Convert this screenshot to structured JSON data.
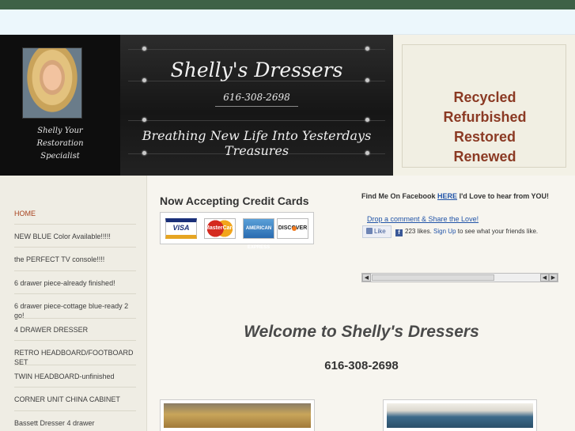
{
  "header": {
    "site_title": "Shelly's Dressers",
    "phone": "616-308-2698",
    "tagline": "Breathing New Life Into Yesterdays Treasures",
    "caption": [
      "Shelly Your",
      "Restoration",
      "Specialist"
    ],
    "words": [
      "Recycled",
      "Refurbished",
      "Restored",
      "Renewed"
    ]
  },
  "sidebar": {
    "items": [
      {
        "label": "HOME",
        "active": true
      },
      {
        "label": "NEW BLUE Color Available!!!!!"
      },
      {
        "label": "the PERFECT TV console!!!!"
      },
      {
        "label": "6 drawer piece-already finished!"
      },
      {
        "label": "6 drawer piece-cottage blue-ready 2 go!"
      },
      {
        "label": "4 DRAWER DRESSER"
      },
      {
        "label": "RETRO HEADBOARD/FOOTBOARD SET"
      },
      {
        "label": "TWIN HEADBOARD-unfinished"
      },
      {
        "label": "CORNER UNIT CHINA CABINET"
      },
      {
        "label": "Bassett Dresser 4 drawer"
      }
    ]
  },
  "credit": {
    "title": "Now Accepting Credit Cards",
    "cards": [
      "VISA",
      "MasterCard",
      "AMERICAN EXPRESS",
      "DISCOVER"
    ]
  },
  "facebook": {
    "prefix": "Find Me On Facebook",
    "link": "HERE",
    "suffix": "I'd Love to hear from YOU!",
    "drop": "Drop a comment & Share the Love!",
    "like": "Like",
    "count_text": "223 likes.",
    "signup": "Sign Up",
    "signup_suffix": "to see what your friends like."
  },
  "main": {
    "welcome": "Welcome to Shelly's Dressers",
    "phone": "616-308-2698"
  },
  "colors": {
    "accent": "#a8431f",
    "words": "#8b3a24",
    "link": "#2154a8",
    "top_strip": "#3e6147"
  }
}
